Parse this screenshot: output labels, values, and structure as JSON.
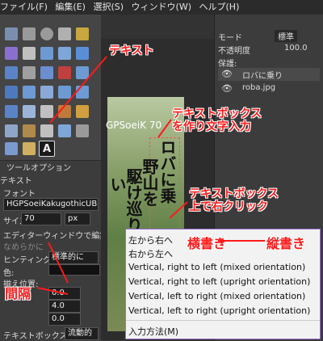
{
  "menubar": {
    "items": [
      "ファイル(F)",
      "編集(E)",
      "選択(S)",
      "ウィンドウ(W)",
      "ヘルプ(H)"
    ]
  },
  "tool_options": {
    "title": "ツールオプション",
    "panel_label": "テキスト",
    "font_label": "フォント",
    "font_value": "HGPSoeiKakugothicUB",
    "size_label": "サイズ:",
    "size_value": "70",
    "size_unit": "px",
    "editor_label": "エディターウィンドウで編集",
    "antialias_label": "なめらかに",
    "hinting_label": "ヒンティング:",
    "hinting_value": "標準的に",
    "color_label": "色:",
    "justify_label": "揃え位置:",
    "spacing": [
      "0.0",
      "4.0",
      "0.0"
    ],
    "textbox_label": "テキストボックス:",
    "textbox_value": "流動的"
  },
  "canvas": {
    "layer_label": "GPSoeiK 70",
    "col1": "ロバに乗",
    "col2": "野山を",
    "col3": "駆け巡りた",
    "col4": "い"
  },
  "dock": {
    "mode_label": "モード",
    "mode_value": "標準",
    "opacity_label": "不透明度",
    "opacity_value": "100.0",
    "lock_label": "保護:",
    "layers": [
      "ロバに乗り",
      "roba.jpg"
    ]
  },
  "context_menu": {
    "items": [
      "左から右へ",
      "右から左へ",
      "Vertical, right to left (mixed orientation)",
      "Vertical, right to left (upright orientation)",
      "Vertical, left to right (mixed orientation)",
      "Vertical, left to right (upright orientation)",
      "入力方法(M)"
    ]
  },
  "annotations": {
    "text_tool": "テキスト",
    "create_box": "テキストボックス\nを作り文字入力",
    "right_click": "テキストボックス\n上で右クリック",
    "horizontal": "横書き",
    "vertical": "縦書き",
    "spacing": "間隔"
  }
}
